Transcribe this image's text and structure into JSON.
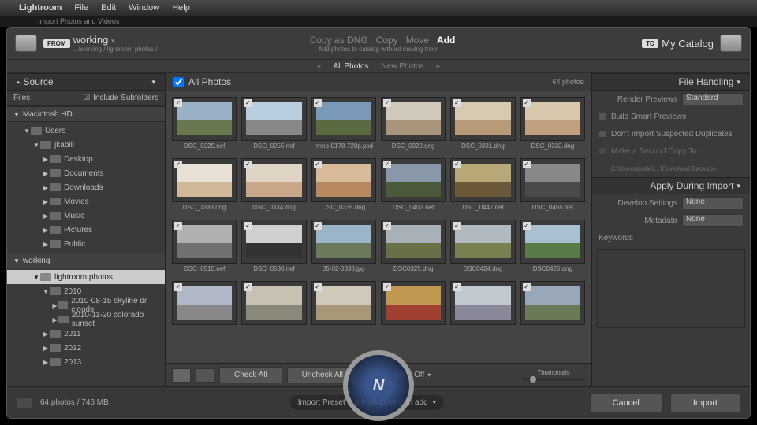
{
  "menubar": {
    "apple": "",
    "app": "Lightroom",
    "items": [
      "File",
      "Edit",
      "Window",
      "Help"
    ]
  },
  "subtitle": "Import Photos and Videos",
  "header": {
    "from_badge": "FROM",
    "from_title": "working",
    "from_sub": ".../working / lightroom photos /",
    "actions": [
      "Copy as DNG",
      "Copy",
      "Move",
      "Add"
    ],
    "action_active_index": 3,
    "action_desc": "Add photos to catalog without moving them",
    "to_badge": "TO",
    "to_title": "My Catalog"
  },
  "tabs": {
    "items": [
      "All Photos",
      "New Photos"
    ],
    "active_index": 0
  },
  "source": {
    "panel_title": "Source",
    "files_label": "Files",
    "include_subfolders_label": "Include Subfolders",
    "include_subfolders_checked": true,
    "volume": "Macintosh HD",
    "tree": [
      {
        "depth": 0,
        "label": "Users",
        "expanded": true
      },
      {
        "depth": 1,
        "label": "jkabili",
        "expanded": true
      },
      {
        "depth": 2,
        "label": "Desktop",
        "expanded": false
      },
      {
        "depth": 2,
        "label": "Documents",
        "expanded": false
      },
      {
        "depth": 2,
        "label": "Downloads",
        "expanded": false
      },
      {
        "depth": 2,
        "label": "Movies",
        "expanded": false
      },
      {
        "depth": 2,
        "label": "Music",
        "expanded": false
      },
      {
        "depth": 2,
        "label": "Pictures",
        "expanded": false
      },
      {
        "depth": 2,
        "label": "Public",
        "expanded": false
      }
    ],
    "working_label": "working",
    "working_tree": [
      {
        "depth": 0,
        "label": "lightroom photos",
        "expanded": true,
        "selected": true
      },
      {
        "depth": 1,
        "label": "2010",
        "expanded": true
      },
      {
        "depth": 2,
        "label": "2010-08-15 skyline dr clouds",
        "expanded": false
      },
      {
        "depth": 2,
        "label": "2010-11-20 colorado sunset",
        "expanded": false
      },
      {
        "depth": 1,
        "label": "2011",
        "expanded": false
      },
      {
        "depth": 1,
        "label": "2012",
        "expanded": false
      },
      {
        "depth": 1,
        "label": "2013",
        "expanded": false
      }
    ]
  },
  "grid": {
    "title": "All Photos",
    "count_label": "64 photos",
    "check_all": "Check All",
    "uncheck_all": "Uncheck All",
    "sort_label": "Sort:",
    "sort_value": "Off",
    "thumbnails_label": "Thumbnails",
    "cells": [
      {
        "file": "DSC_0229.nef",
        "c1": "#9ab0c4",
        "c2": "#6a7850"
      },
      {
        "file": "DSC_0255.nef",
        "c1": "#b8cde0",
        "c2": "#888"
      },
      {
        "file": "rmnp-0178-720p.psd",
        "c1": "#7a98b8",
        "c2": "#5a6a40"
      },
      {
        "file": "DSC_0329.dng",
        "c1": "#d0c8b8",
        "c2": "#a8947a"
      },
      {
        "file": "DSC_0331.dng",
        "c1": "#d8cab0",
        "c2": "#b89a78"
      },
      {
        "file": "DSC_0332.dng",
        "c1": "#d8c8ae",
        "c2": "#c0a080"
      },
      {
        "file": "DSC_0333.dng",
        "c1": "#e8e0d4",
        "c2": "#d0b89a"
      },
      {
        "file": "DSC_0334.dng",
        "c1": "#e0d4c4",
        "c2": "#c8a888"
      },
      {
        "file": "DSC_0335.dng",
        "c1": "#d8ba98",
        "c2": "#b88860"
      },
      {
        "file": "DSC_0402.nef",
        "c1": "#8898a8",
        "c2": "#4a5a3a"
      },
      {
        "file": "DSC_0447.nef",
        "c1": "#b8a878",
        "c2": "#6a5838"
      },
      {
        "file": "DSC_0455.nef",
        "c1": "#888",
        "c2": "#4a4a4a"
      },
      {
        "file": "DSC_0515.nef",
        "c1": "#b0b0b0",
        "c2": "#707070"
      },
      {
        "file": "DSC_0530.nef",
        "c1": "#d0d0d0",
        "c2": "#333"
      },
      {
        "file": "05-02-0338.jpg",
        "c1": "#9ab4c8",
        "c2": "#6a7a5a"
      },
      {
        "file": "DSC0325.dng",
        "c1": "#a8b0b8",
        "c2": "#687048"
      },
      {
        "file": "DSC0424.dng",
        "c1": "#b0b8c0",
        "c2": "#788050"
      },
      {
        "file": "DSC0425.dng",
        "c1": "#a8c0d0",
        "c2": "#5a7a48"
      },
      {
        "file": "",
        "c1": "#b0b8c8",
        "c2": "#888"
      },
      {
        "file": "",
        "c1": "#c8c0b0",
        "c2": "#8a8878"
      },
      {
        "file": "",
        "c1": "#d0c8b8",
        "c2": "#a89878"
      },
      {
        "file": "",
        "c1": "#c09850",
        "c2": "#a04030"
      },
      {
        "file": "",
        "c1": "#c0c8d0",
        "c2": "#888898"
      },
      {
        "file": "",
        "c1": "#98a8b8",
        "c2": "#6a7a58"
      }
    ]
  },
  "file_handling": {
    "panel_title": "File Handling",
    "render_label": "Render Previews",
    "render_value": "Standard",
    "smart_label": "Build Smart Previews",
    "dup_label": "Don't Import Suspected Duplicates",
    "second_copy_label": "Make a Second Copy To :",
    "second_copy_path": "C:\\Users\\jkabili\\...\\Download Backups"
  },
  "apply_import": {
    "panel_title": "Apply During Import",
    "develop_label": "Develop Settings",
    "develop_value": "None",
    "metadata_label": "Metadata",
    "metadata_value": "None",
    "keywords_label": "Keywords"
  },
  "footer": {
    "status": "64 photos / 746 MB",
    "preset_label": "Import Preset :",
    "preset_value": "rt from drive with add",
    "cancel": "Cancel",
    "import": "Import"
  }
}
